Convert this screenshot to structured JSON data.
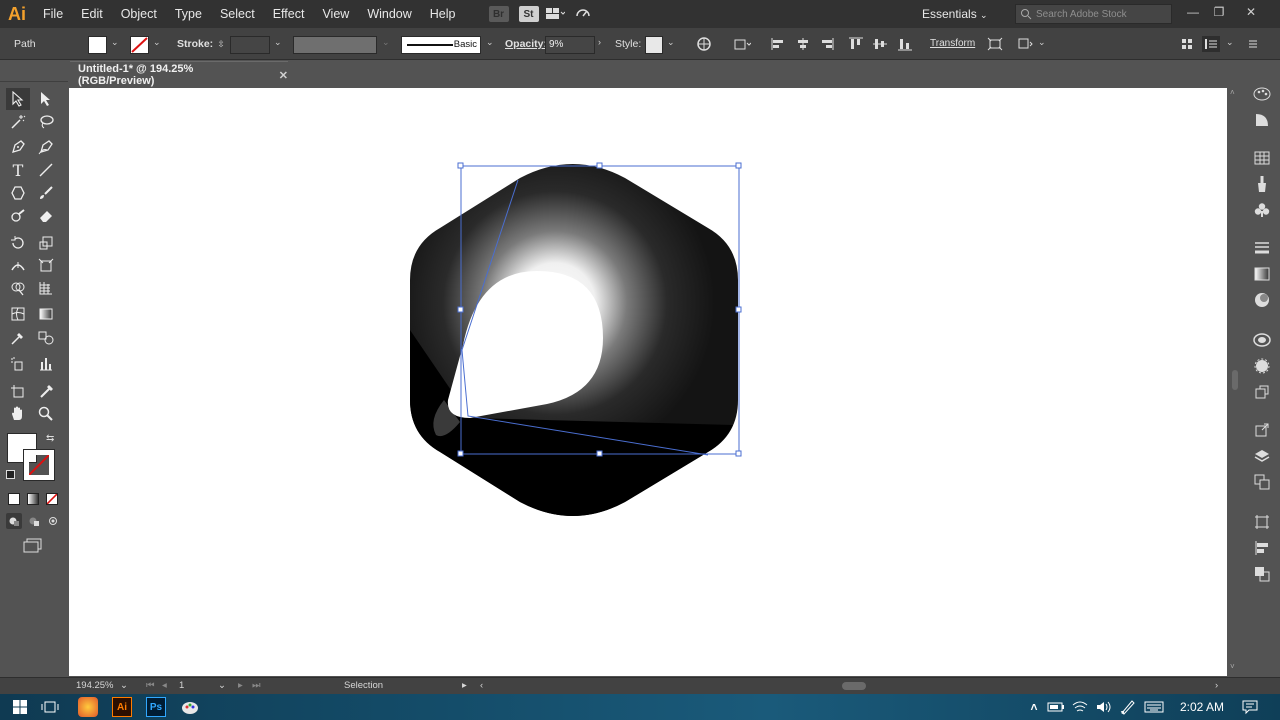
{
  "app": {
    "logo": "Ai"
  },
  "menu": [
    "File",
    "Edit",
    "Object",
    "Type",
    "Select",
    "Effect",
    "View",
    "Window",
    "Help"
  ],
  "menubar_icons": {
    "bridge": "Br",
    "stock": "St"
  },
  "workspace": "Essentials",
  "search": {
    "placeholder": "Search Adobe Stock"
  },
  "controlbar": {
    "selection_type": "Path",
    "stroke_label": "Stroke:",
    "brush_label": "Basic",
    "opacity_label": "Opacity:",
    "opacity_value": "9%",
    "style_label": "Style:",
    "transform_label": "Transform"
  },
  "document_tab": {
    "title": "Untitled-1* @ 194.25% (RGB/Preview)",
    "close": "✕"
  },
  "status": {
    "zoom": "194.25%",
    "artboard": "1",
    "tool": "Selection"
  },
  "taskbar": {
    "time": "2:02 AM",
    "ai_label": "Ai",
    "ps_label": "Ps"
  },
  "colors": {
    "accent": "#4a6ed0",
    "logo": "#f4a12c",
    "taskbar": "#134a66"
  }
}
